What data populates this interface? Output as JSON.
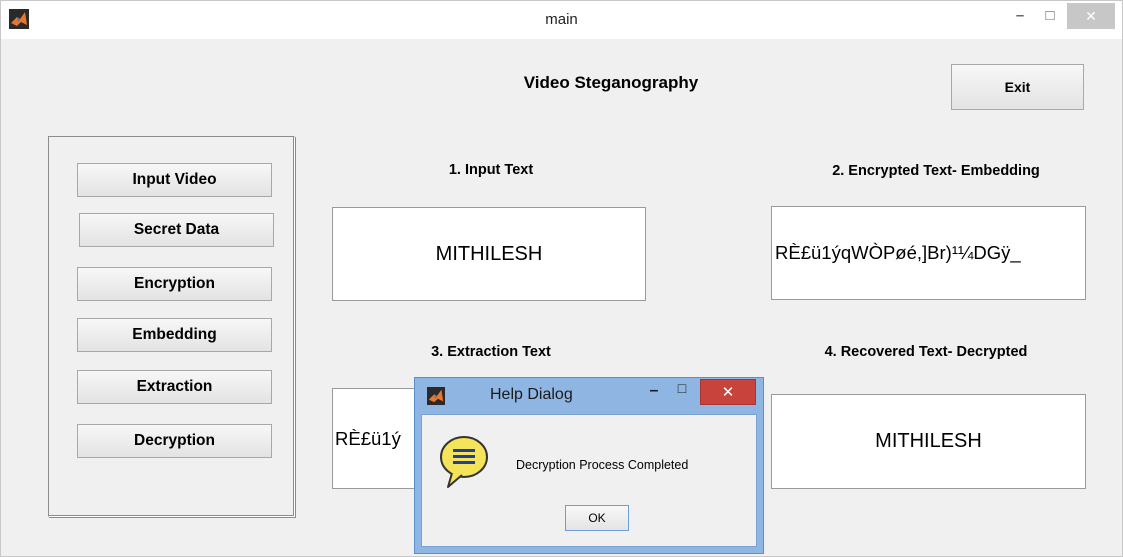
{
  "window": {
    "title": "main"
  },
  "heading": "Video Steganography",
  "exit_label": "Exit",
  "sidebar": {
    "buttons": [
      {
        "label": "Input Video"
      },
      {
        "label": "Secret Data"
      },
      {
        "label": "Encryption"
      },
      {
        "label": "Embedding"
      },
      {
        "label": "Extraction"
      },
      {
        "label": "Decryption"
      }
    ]
  },
  "sections": {
    "input": {
      "label": "1. Input Text",
      "value": "MITHILESH"
    },
    "encrypted": {
      "label": "2. Encrypted  Text- Embedding",
      "value": "RÈ£ü1ýqWÒPøé,]Br)¹¼DGÿ_"
    },
    "extraction": {
      "label": "3. Extraction  Text",
      "value": "RÈ£ü1ý"
    },
    "recovered": {
      "label": "4. Recovered Text- Decrypted",
      "value": "MITHILESH"
    }
  },
  "dialog": {
    "title": "Help Dialog",
    "message": "Decryption Process Completed",
    "ok_label": "OK"
  },
  "icons": {
    "app": "matlab-logo-icon",
    "help": "help-speech-bubble-icon"
  },
  "colors": {
    "window_bg": "#f0f0f0",
    "dialog_frame": "#8fb6e3",
    "close_red": "#c7433c"
  }
}
